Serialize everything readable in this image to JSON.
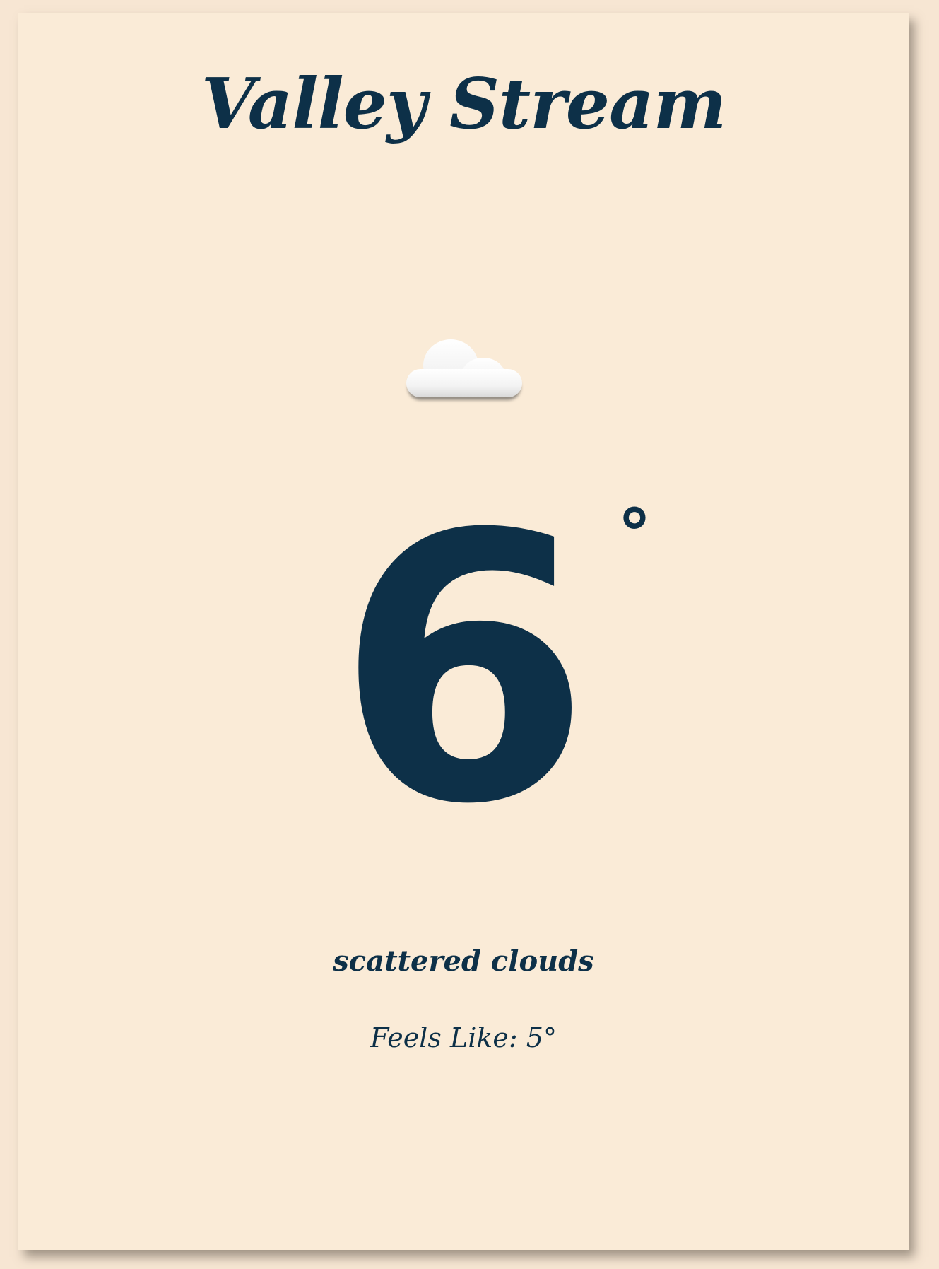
{
  "weather": {
    "city": "Valley Stream",
    "icon": "cloud-icon",
    "temperature": "6",
    "temperature_unit": "°",
    "condition": "scattered clouds",
    "feels_like": "Feels Like: 5°"
  },
  "colors": {
    "background": "#faebd7",
    "text": "#0d3048"
  }
}
